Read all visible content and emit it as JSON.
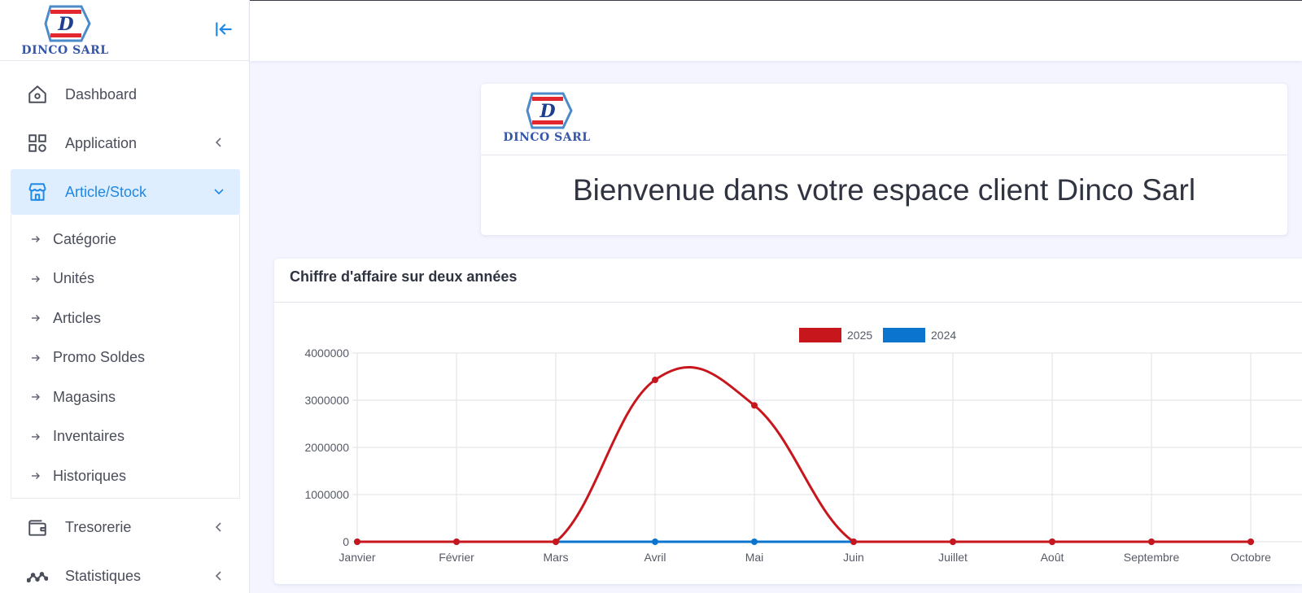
{
  "brand": {
    "name": "DINCO SARL",
    "letter": "D"
  },
  "sidebar": {
    "collapse_icon": "collapse-left-icon",
    "items": [
      {
        "label": "Dashboard",
        "icon": "home-icon",
        "chevron": ""
      },
      {
        "label": "Application",
        "icon": "grid-icon",
        "chevron": "chevron-left-icon"
      },
      {
        "label": "Article/Stock",
        "icon": "store-icon",
        "chevron": "chevron-down-icon",
        "active": true
      },
      {
        "label": "Tresorerie",
        "icon": "wallet-icon",
        "chevron": "chevron-left-icon"
      },
      {
        "label": "Statistiques",
        "icon": "trend-icon",
        "chevron": "chevron-left-icon"
      }
    ],
    "subitems": [
      "Catégorie",
      "Unités",
      "Articles",
      "Promo Soldes",
      "Magasins",
      "Inventaires",
      "Historiques"
    ]
  },
  "welcome": {
    "title": "Bienvenue dans votre espace client Dinco Sarl"
  },
  "chart_card": {
    "title": "Chiffre d'affaire sur deux années"
  },
  "colors": {
    "accent": "#1e88e5",
    "active_bg": "#dfeeff",
    "series_2025": "#c8161d",
    "series_2024": "#0b74cf",
    "brand_text": "#3556a8"
  },
  "chart_data": {
    "type": "line",
    "categories": [
      "Janvier",
      "Février",
      "Mars",
      "Avril",
      "Mai",
      "Juin",
      "Juillet",
      "Août",
      "Septembre",
      "Octobre"
    ],
    "series": [
      {
        "name": "2025",
        "color": "#c8161d",
        "values": [
          0,
          0,
          0,
          3430000,
          2890000,
          0,
          0,
          0,
          0,
          0
        ]
      },
      {
        "name": "2024",
        "color": "#0b74cf",
        "values": [
          0,
          0,
          0,
          0,
          0,
          0,
          0,
          0,
          0,
          0
        ]
      }
    ],
    "yticks": [
      "0",
      "1000000",
      "2000000",
      "3000000",
      "4000000"
    ],
    "ylim": [
      0,
      4000000
    ],
    "grid": true,
    "legend": "top-center",
    "smooth": true
  }
}
